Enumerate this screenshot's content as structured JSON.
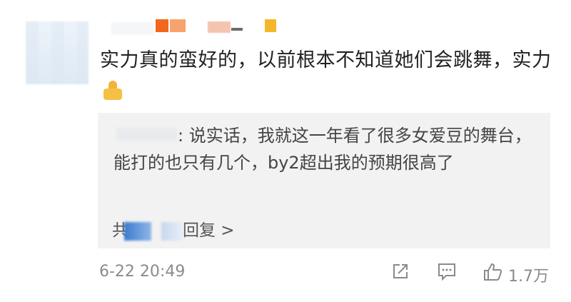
{
  "comment": {
    "text": "实力真的蛮好的，以前根本不知道她们会跳舞，实力",
    "emoji": "thumbs-up"
  },
  "reply": {
    "text": "说实话，我就这一年看了很多女爱豆的舞台，能打的也只有几个，by2超出我的预期很高了",
    "more_label": "回复 >"
  },
  "footer": {
    "timestamp": "6-22 20:49",
    "like_count": "1.7万"
  }
}
